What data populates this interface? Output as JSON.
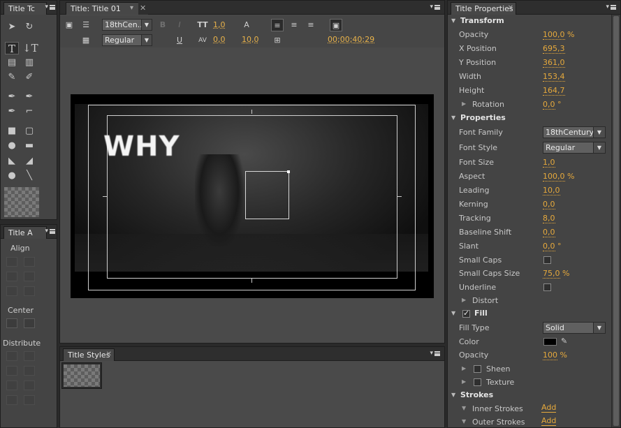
{
  "tools_panel": {
    "tab_label": "Title Tc",
    "align_tab_label": "Title A",
    "align_label": "Align",
    "center_label": "Center",
    "distribute_label": "Distribute"
  },
  "title_panel": {
    "tab_label": "Title: Title 01",
    "font_family": "18thCen...",
    "font_style": "Regular",
    "font_size": "1,0",
    "kerning": "0,0",
    "leading": "10,0",
    "timecode": "00;00;40;29",
    "canvas_text": "WHY"
  },
  "styles_panel": {
    "tab_label": "Title Styles"
  },
  "properties_panel": {
    "tab_label": "Title Properties",
    "transform": {
      "header": "Transform",
      "opacity": {
        "label": "Opacity",
        "value": "100,0",
        "unit": " %"
      },
      "x_position": {
        "label": "X Position",
        "value": "695,3"
      },
      "y_position": {
        "label": "Y Position",
        "value": "361,0"
      },
      "width": {
        "label": "Width",
        "value": "153,4"
      },
      "height": {
        "label": "Height",
        "value": "164,7"
      },
      "rotation": {
        "label": "Rotation",
        "value": "0,0",
        "unit": " °"
      }
    },
    "properties": {
      "header": "Properties",
      "font_family": {
        "label": "Font Family",
        "value": "18thCentury"
      },
      "font_style": {
        "label": "Font Style",
        "value": "Regular"
      },
      "font_size": {
        "label": "Font Size",
        "value": "1,0"
      },
      "aspect": {
        "label": "Aspect",
        "value": "100,0",
        "unit": " %"
      },
      "leading": {
        "label": "Leading",
        "value": "10,0"
      },
      "kerning": {
        "label": "Kerning",
        "value": "0,0"
      },
      "tracking": {
        "label": "Tracking",
        "value": "8,0"
      },
      "baseline_shift": {
        "label": "Baseline Shift",
        "value": "0,0"
      },
      "slant": {
        "label": "Slant",
        "value": "0,0",
        "unit": " °"
      },
      "small_caps": {
        "label": "Small Caps"
      },
      "small_caps_size": {
        "label": "Small Caps Size",
        "value": "75,0",
        "unit": " %"
      },
      "underline": {
        "label": "Underline"
      },
      "distort": {
        "label": "Distort"
      }
    },
    "fill": {
      "header": "Fill",
      "fill_type": {
        "label": "Fill Type",
        "value": "Solid"
      },
      "color": {
        "label": "Color"
      },
      "opacity": {
        "label": "Opacity",
        "value": "100",
        "unit": " %"
      },
      "sheen": {
        "label": "Sheen"
      },
      "texture": {
        "label": "Texture"
      }
    },
    "strokes": {
      "header": "Strokes",
      "inner": {
        "label": "Inner Strokes",
        "action": "Add"
      },
      "outer": {
        "label": "Outer Strokes",
        "action": "Add"
      }
    }
  },
  "colors": {
    "accent_value": "#e6a93c",
    "fill_color": "#000000"
  }
}
